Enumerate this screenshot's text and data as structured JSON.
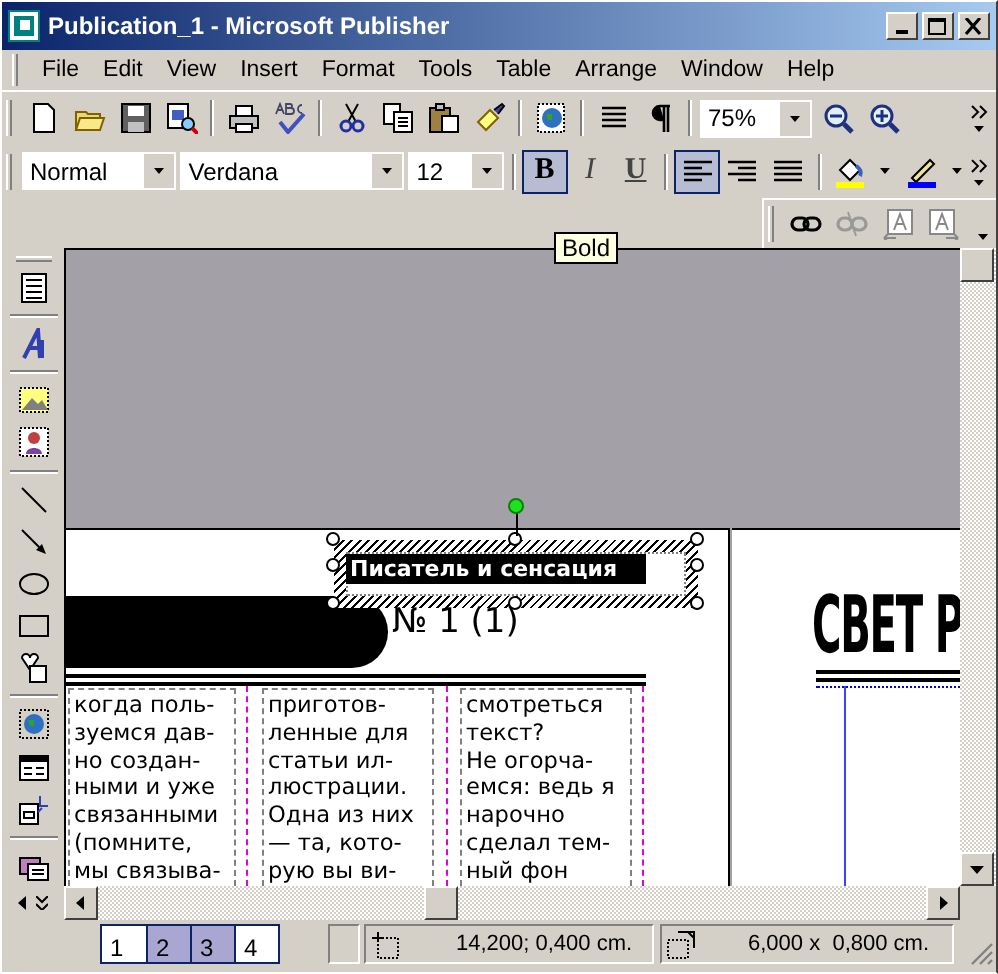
{
  "window": {
    "title": "Publication_1 - Microsoft Publisher"
  },
  "menu": [
    {
      "label": "File"
    },
    {
      "label": "Edit"
    },
    {
      "label": "View"
    },
    {
      "label": "Insert"
    },
    {
      "label": "Format"
    },
    {
      "label": "Tools"
    },
    {
      "label": "Table"
    },
    {
      "label": "Arrange"
    },
    {
      "label": "Window"
    },
    {
      "label": "Help"
    }
  ],
  "standard_toolbar": {
    "zoom": "75%"
  },
  "formatting_toolbar": {
    "style": "Normal",
    "font": "Verdana",
    "size": "12",
    "buttons": [
      {
        "kind": "bold",
        "label": "B",
        "selected": true
      },
      {
        "kind": "italic",
        "label": "I",
        "selected": false
      },
      {
        "kind": "underline",
        "label": "U",
        "selected": false
      }
    ],
    "alignment": [
      {
        "kind": "left",
        "selected": true
      },
      {
        "kind": "right",
        "selected": false
      },
      {
        "kind": "justify",
        "selected": false
      }
    ]
  },
  "connect_toolbar": {
    "buttons": [
      {
        "kind": "link",
        "disabled": false
      },
      {
        "kind": "unlink",
        "disabled": true
      },
      {
        "kind": "previous",
        "disabled": true
      },
      {
        "kind": "next",
        "disabled": true
      }
    ]
  },
  "tooltip": "Bold",
  "publication": {
    "title_box": {
      "text": "Писатель и сенсация",
      "selected": true
    },
    "issue": "№ 1 (1)",
    "heading": "СВЕТ Р",
    "columns": [
      {
        "lines": [
          "когда поль-",
          "зуемся дав-",
          "но создан-",
          "ными и уже",
          "связанными",
          "(помните,",
          "мы связыва-"
        ]
      },
      {
        "lines": [
          "приготов-",
          "ленные для",
          "статьи ил-",
          "люстрации.",
          "Одна из них",
          "— та, кото-",
          "рую вы ви-"
        ]
      },
      {
        "lines": [
          "смотреться",
          "текст?",
          "Не огорча-",
          "емся: ведь я",
          "нарочно",
          "сделал тем-",
          "ный фон"
        ]
      }
    ]
  },
  "page_tabs": [
    {
      "label": "1",
      "selected": false
    },
    {
      "label": "2",
      "selected": true
    },
    {
      "label": "3",
      "selected": true
    },
    {
      "label": "4",
      "selected": false
    }
  ],
  "status_bar": {
    "position": "14,200; 0,400 cm.",
    "size": "6,000 x  0,800 cm."
  }
}
